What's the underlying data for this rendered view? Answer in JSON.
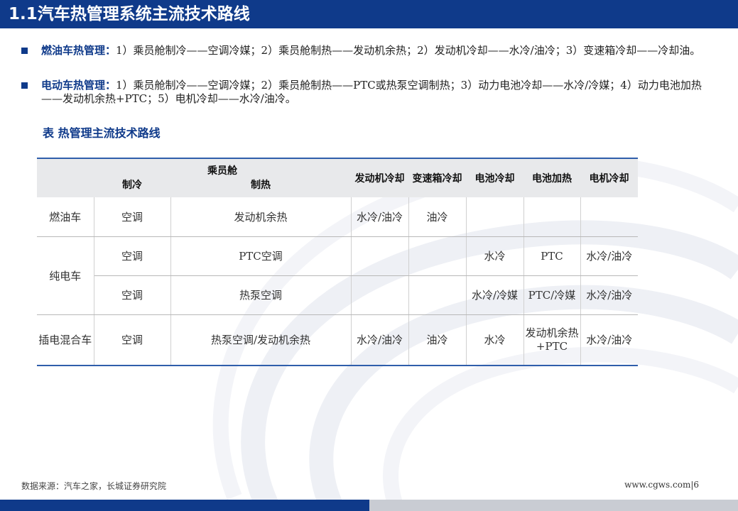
{
  "header": {
    "title": "1.1汽车热管理系统主流技术路线"
  },
  "bullets": [
    {
      "head": "燃油车热管理：",
      "text": "1）乘员舱制冷——空调冷媒；2）乘员舱制热——发动机余热；2）发动机冷却——水冷/油冷；3）变速箱冷却——冷却油。"
    },
    {
      "head": "电动车热管理：",
      "text": "1）乘员舱制冷——空调冷媒；2）乘员舱制热——PTC或热泵空调制热；3）动力电池冷却——水冷/冷媒；4）动力电池加热——发动机余热+PTC；5）电机冷却——水冷/油冷。"
    }
  ],
  "table": {
    "caption": "表 热管理主流技术路线",
    "header": {
      "group": "乘员舱",
      "cooling": "制冷",
      "heating": "制热",
      "engine_cooling": "发动机冷却",
      "gearbox_cooling": "变速箱冷却",
      "battery_cooling": "电池冷却",
      "battery_heating": "电池加热",
      "motor_cooling": "电机冷却"
    },
    "rows": [
      {
        "type": "燃油车",
        "cooling": "空调",
        "heating": "发动机余热",
        "engine": "水冷/油冷",
        "gearbox": "油冷",
        "bat_cool": "",
        "bat_heat": "",
        "motor": ""
      },
      {
        "type": "纯电车",
        "cooling": "空调",
        "heating": "PTC空调",
        "engine": "",
        "gearbox": "",
        "bat_cool": "水冷",
        "bat_heat": "PTC",
        "motor": "水冷/油冷"
      },
      {
        "type": "",
        "cooling": "空调",
        "heating": "热泵空调",
        "engine": "",
        "gearbox": "",
        "bat_cool": "水冷/冷媒",
        "bat_heat": "PTC/冷媒",
        "motor": "水冷/油冷"
      },
      {
        "type": "插电混合车",
        "cooling": "空调",
        "heating": "热泵空调/发动机余热",
        "engine": "水冷/油冷",
        "gearbox": "油冷",
        "bat_cool": "水冷",
        "bat_heat": "发动机余热+PTC",
        "motor": "水冷/油冷"
      }
    ]
  },
  "footer": {
    "source": "数据来源：汽车之家，长城证券研究院",
    "url": "www.cgws.com|6"
  },
  "colors": {
    "brand_blue": "#0f3a8a",
    "rule_blue": "#2f5eab",
    "header_grey": "#e8e9eb"
  }
}
